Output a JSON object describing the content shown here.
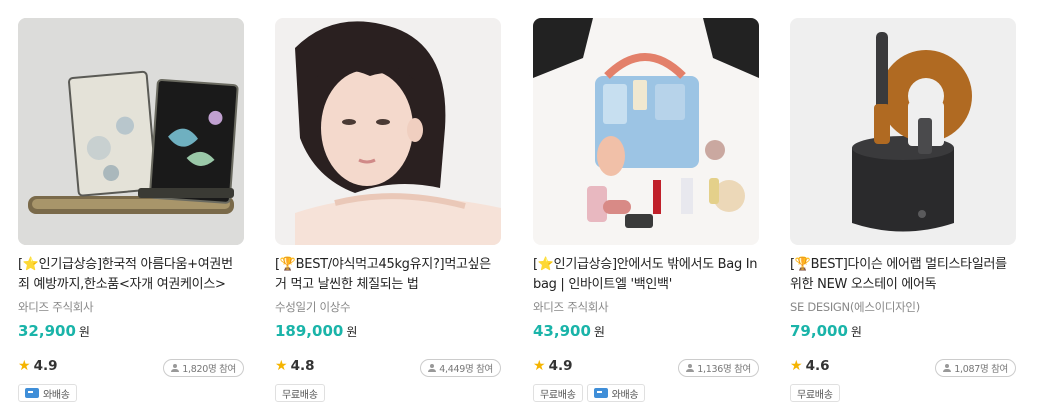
{
  "products": [
    {
      "badge_icon": "star-badge-icon",
      "title": "[⭐인기급상승]한국적 아름다움+여권번죄 예방까지,한소품<자개 여권케이스>",
      "seller": "와디즈 주식회사",
      "price": "32,900",
      "currency": "원",
      "rating": "4.9",
      "participants": "1,820명 참여",
      "tags": [
        {
          "label": "와배송",
          "icon": "truck-icon"
        }
      ]
    },
    {
      "badge_icon": "trophy-badge-icon",
      "title": "[🏆BEST/야식먹고45kg유지?]먹고싶은거 먹고 날씬한 체질되는 법",
      "seller": "수성일기 이상수",
      "price": "189,000",
      "currency": "원",
      "rating": "4.8",
      "participants": "4,449명 참여",
      "tags": [
        {
          "label": "무료배송",
          "icon": ""
        }
      ]
    },
    {
      "badge_icon": "star-badge-icon",
      "title": "[⭐인기급상승]안에서도 밖에서도 Bag In bag | 인바이트엘 '백인백'",
      "seller": "와디즈 주식회사",
      "price": "43,900",
      "currency": "원",
      "rating": "4.9",
      "participants": "1,136명 참여",
      "tags": [
        {
          "label": "무료배송",
          "icon": ""
        },
        {
          "label": "와배송",
          "icon": "truck-icon"
        }
      ]
    },
    {
      "badge_icon": "trophy-badge-icon",
      "title": "[🏆BEST]다이슨 에어랩 멀티스타일러를 위한 NEW 오스테이 에어독",
      "seller": "SE DESIGN(에스이디자인)",
      "price": "79,000",
      "currency": "원",
      "rating": "4.6",
      "participants": "1,087명 참여",
      "tags": [
        {
          "label": "무료배송",
          "icon": ""
        }
      ]
    }
  ],
  "colors": {
    "price": "#1ab4a9",
    "star": "#f5b400",
    "tag_truck": "#3f8ed8"
  }
}
